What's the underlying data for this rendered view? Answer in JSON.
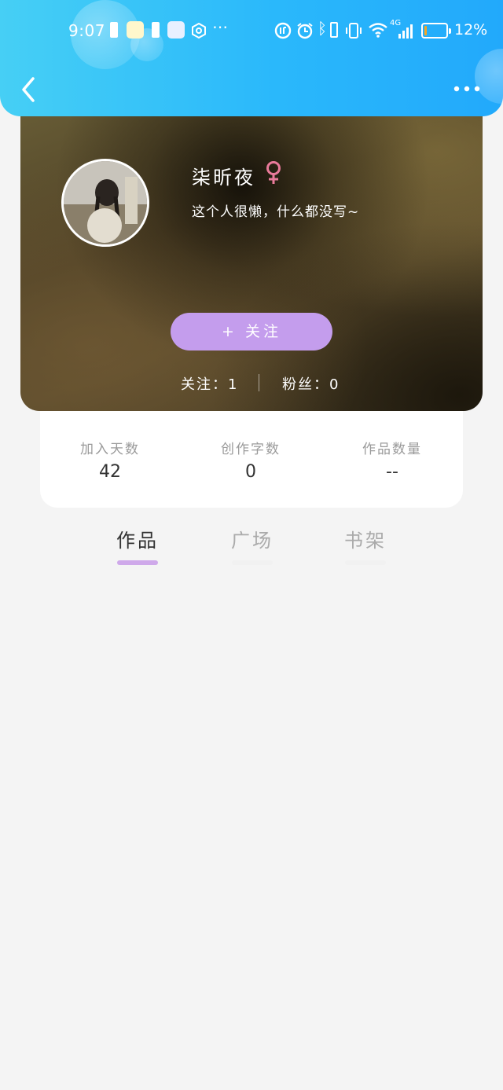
{
  "status_bar": {
    "time": "9:07",
    "network": "4G",
    "battery_percent": "12%",
    "battery_level": 0.12,
    "battery_color": "#f5a623"
  },
  "header": {
    "back_icon": "chevron-left-icon",
    "more_icon": "more-dots-icon",
    "background": "#2ab8fb"
  },
  "profile": {
    "username": "柒昕夜",
    "gender_icon": "female-icon",
    "gender_color": "#e97a9a",
    "bio": "这个人很懒，什么都没写~",
    "follow_button": "+ 关注",
    "follow_button_color": "#c49ded",
    "following": "关注：1",
    "followers": "粉丝：0"
  },
  "stats": [
    {
      "label": "加入天数",
      "value": "42"
    },
    {
      "label": "创作字数",
      "value": "0"
    },
    {
      "label": "作品数量",
      "value": "--"
    }
  ],
  "tabs": [
    {
      "label": "作品",
      "active": true
    },
    {
      "label": "广场",
      "active": false
    },
    {
      "label": "书架",
      "active": false
    }
  ],
  "colors": {
    "tab_active_text": "#333333",
    "tab_inactive_text": "#aaaaaa",
    "tab_active_underline": "#cfa9ea",
    "tab_inactive_underline": "#f1f1f1",
    "page_background": "#f4f4f4"
  }
}
